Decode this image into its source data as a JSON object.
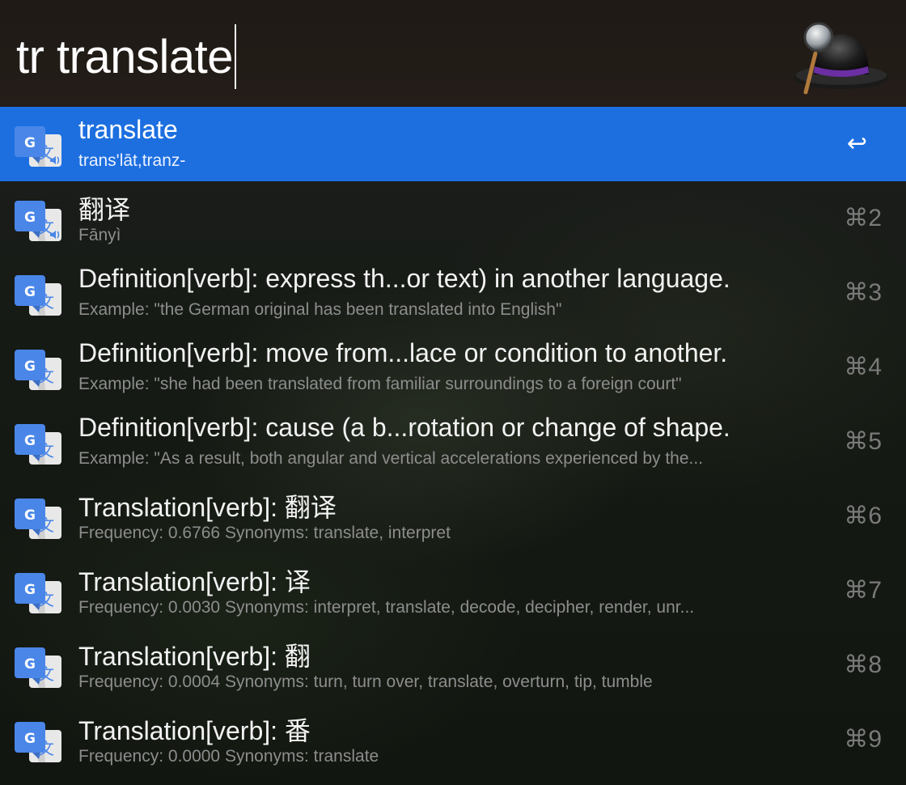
{
  "search": {
    "query": "tr translate"
  },
  "colors": {
    "selection": "#1d6fe0",
    "title_text": "#f2f2f2",
    "subtitle_text": "#8d8d8d",
    "shortcut_text": "#7a7a7a"
  },
  "icons": {
    "result_icon": "google-translate-icon",
    "app_logo": "alfred-hat-icon",
    "return": "return-key-icon"
  },
  "results": [
    {
      "title": "translate",
      "subtitle": "trans'lāt,tranz-",
      "shortcut": "↩",
      "selected": true,
      "speaker": true
    },
    {
      "title": "翻译",
      "subtitle": "Fānyì",
      "shortcut": "⌘2",
      "selected": false,
      "speaker": true
    },
    {
      "title": "Definition[verb]: express th...or text) in another language.",
      "subtitle": "Example: \"the German original has been translated into English\"",
      "shortcut": "⌘3",
      "selected": false,
      "speaker": false
    },
    {
      "title": "Definition[verb]: move from...lace or condition to another.",
      "subtitle": "Example: \"she had been translated from familiar surroundings to a foreign court\"",
      "shortcut": "⌘4",
      "selected": false,
      "speaker": false
    },
    {
      "title": "Definition[verb]: cause (a b...rotation or change of shape.",
      "subtitle": "Example: \"As a result, both angular and vertical accelerations experienced by the...",
      "shortcut": "⌘5",
      "selected": false,
      "speaker": false
    },
    {
      "title": "Translation[verb]: 翻译",
      "subtitle": "Frequency: 0.6766 Synonyms: translate, interpret",
      "shortcut": "⌘6",
      "selected": false,
      "speaker": false
    },
    {
      "title": "Translation[verb]: 译",
      "subtitle": "Frequency: 0.0030 Synonyms: interpret, translate, decode, decipher, render, unr...",
      "shortcut": "⌘7",
      "selected": false,
      "speaker": false
    },
    {
      "title": "Translation[verb]: 翻",
      "subtitle": "Frequency: 0.0004 Synonyms: turn, turn over, translate, overturn, tip, tumble",
      "shortcut": "⌘8",
      "selected": false,
      "speaker": false
    },
    {
      "title": "Translation[verb]: 番",
      "subtitle": "Frequency: 0.0000 Synonyms: translate",
      "shortcut": "⌘9",
      "selected": false,
      "speaker": false
    }
  ]
}
